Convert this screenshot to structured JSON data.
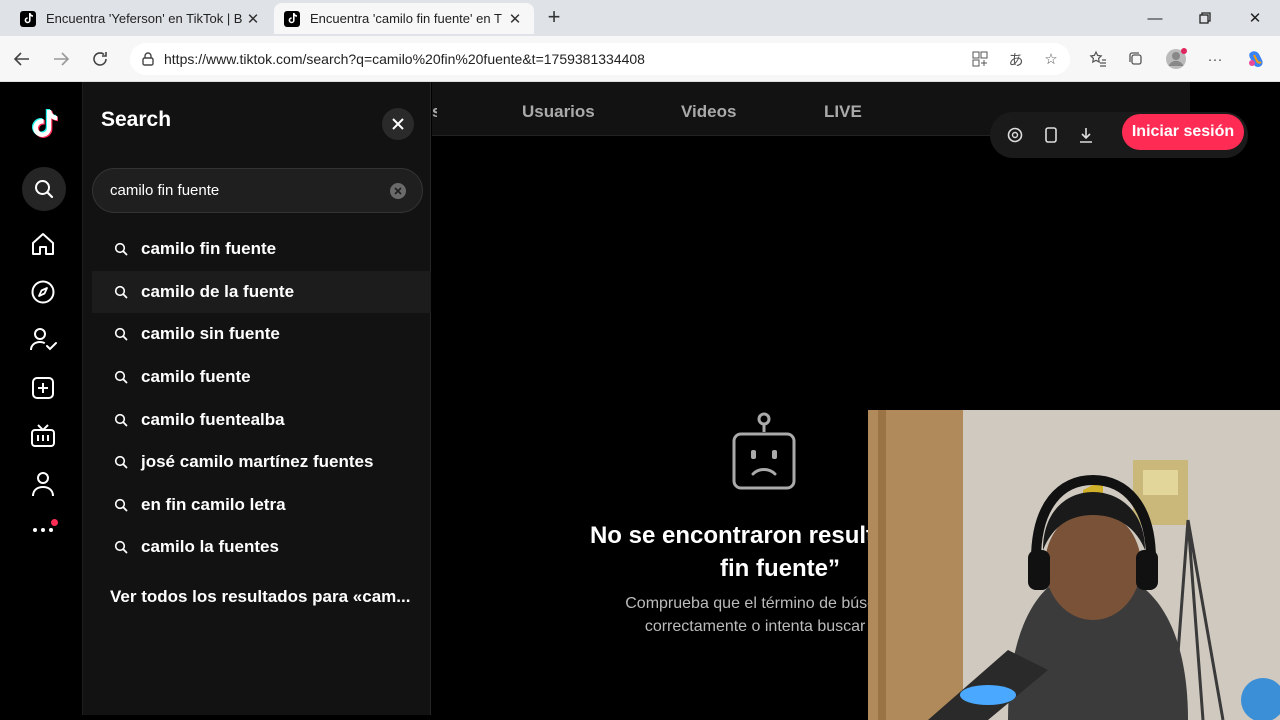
{
  "browser": {
    "tabs": [
      {
        "title": "Encuentra 'Yeferson' en TikTok | B",
        "active": false
      },
      {
        "title": "Encuentra 'camilo fin fuente' en T",
        "active": true
      }
    ],
    "url": "https://www.tiktok.com/search?q=camilo%20fin%20fuente&t=1759381334408"
  },
  "search_panel": {
    "title": "Search",
    "query": "camilo fin fuente",
    "suggestions": [
      "camilo fin fuente",
      "camilo de la fuente",
      "camilo sin fuente",
      "camilo fuente",
      "camilo fuentealba",
      "josé camilo martínez fuentes",
      "en fin camilo letra",
      "camilo la fuentes"
    ],
    "see_all": "Ver todos los resultados para «cam..."
  },
  "main": {
    "tabs": [
      "Usuarios",
      "Videos",
      "LIVE"
    ],
    "login_label": "Iniciar sesión",
    "empty_title_line1": "No se encontraron resultados",
    "empty_title_line2": "fin fuente”",
    "empty_desc_line1": "Comprueba que el término de búsqued",
    "empty_desc_line2": "correctamente o intenta buscar ot"
  },
  "colors": {
    "accent": "#fe2c55",
    "background": "#000000",
    "panel": "#121212"
  },
  "icons": {
    "rail": [
      "tiktok-logo",
      "search-icon",
      "home-icon",
      "explore-icon",
      "following-icon",
      "upload-icon",
      "live-icon",
      "profile-icon",
      "more-icon"
    ]
  }
}
